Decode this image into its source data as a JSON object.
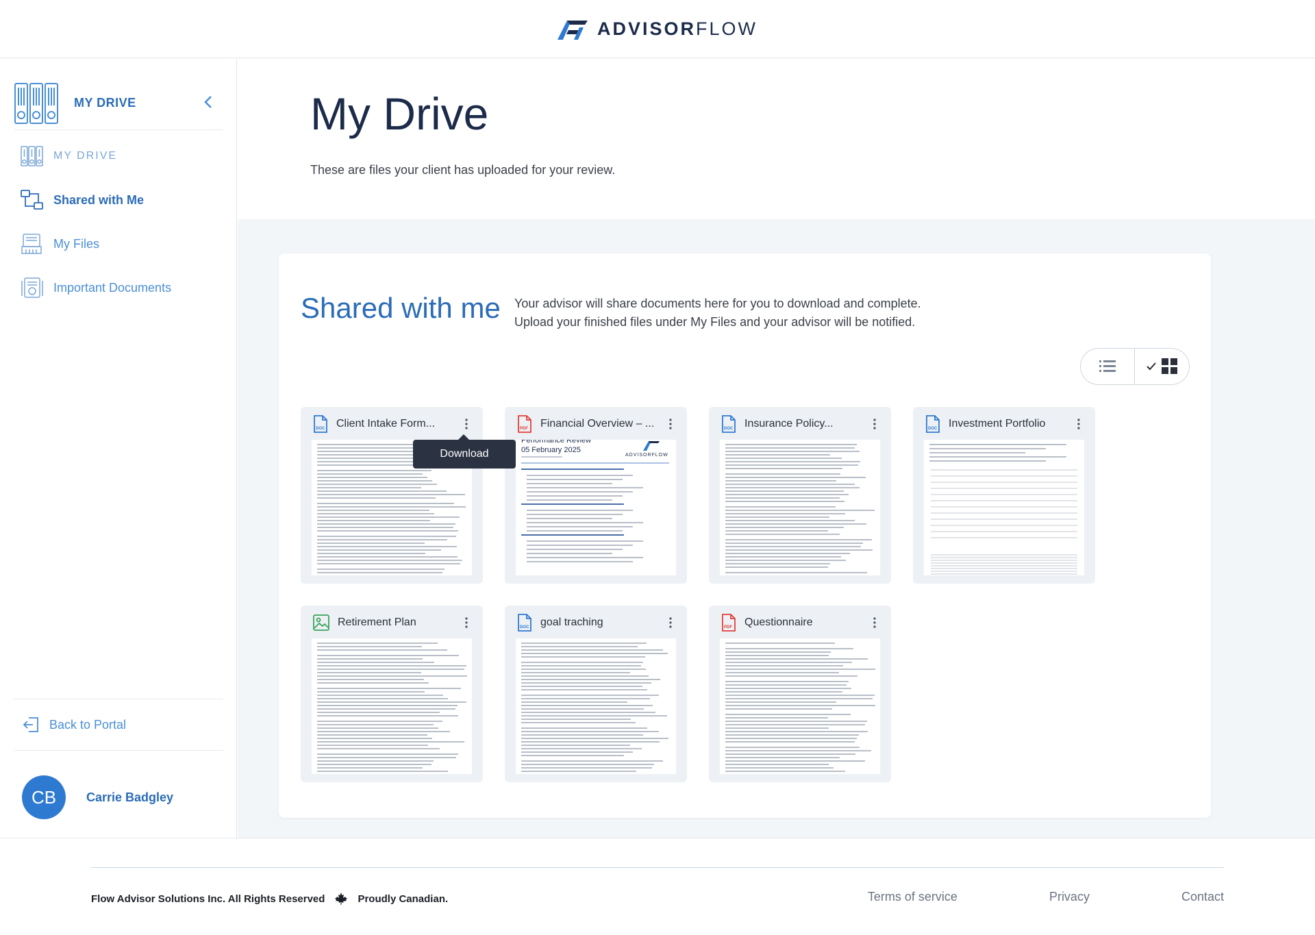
{
  "brand": {
    "part1": "ADVISOR",
    "part2": "FLOW"
  },
  "sidebar": {
    "title": "MY DRIVE",
    "items": [
      {
        "label": "MY DRIVE",
        "icon": "drive-icon"
      },
      {
        "label": "Shared with Me",
        "icon": "shared-icon"
      },
      {
        "label": "My Files",
        "icon": "files-icon"
      },
      {
        "label": "Important Documents",
        "icon": "important-icon"
      }
    ],
    "back_label": "Back to Portal",
    "user": {
      "initials": "CB",
      "name": "Carrie Badgley"
    }
  },
  "page": {
    "title": "My Drive",
    "subtitle": "These are files your client has uploaded for your review."
  },
  "shared": {
    "title": "Shared with me",
    "desc_line1": "Your advisor will share documents here for you to download and complete.",
    "desc_line2": "Upload your finished files under My Files and your advisor will be notified."
  },
  "files": [
    {
      "name": "Client Intake Form...",
      "type": "doc"
    },
    {
      "name": "Financial Overview – ...",
      "type": "pdf"
    },
    {
      "name": "Insurance Policy...",
      "type": "doc"
    },
    {
      "name": "Investment Portfolio",
      "type": "doc"
    },
    {
      "name": "Retirement Plan",
      "type": "image"
    },
    {
      "name": "goal traching",
      "type": "doc"
    },
    {
      "name": "Questionnaire",
      "type": "pdf"
    }
  ],
  "thumb_text": {
    "review_title": "Performance Review",
    "review_date": "05 February 2025",
    "review_logo": "ADVISORFLOW"
  },
  "tooltip": {
    "label": "Download"
  },
  "footer": {
    "copyright": "Flow Advisor Solutions Inc. All Rights Reserved",
    "canadian": "Proudly Canadian.",
    "links": [
      "Terms of service",
      "Privacy",
      "Contact"
    ]
  },
  "colors": {
    "accent": "#2b6cb8",
    "navy": "#1c2b4a",
    "doc": "#2f7ad1",
    "pdf": "#e0403a",
    "image": "#3aa35a"
  }
}
